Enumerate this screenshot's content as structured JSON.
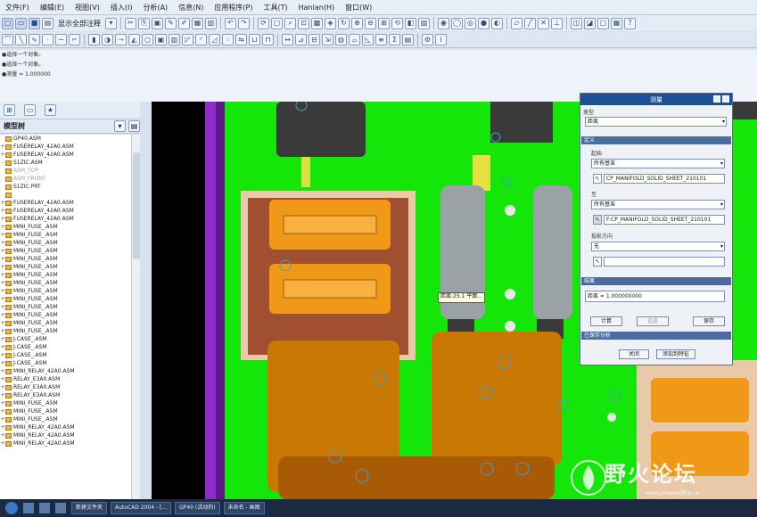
{
  "menu": [
    "文件(F)",
    "编辑(E)",
    "视图(V)",
    "插入(I)",
    "分析(A)",
    "信息(N)",
    "应用程序(P)",
    "工具(T)",
    "Hanlan(H)",
    "窗口(W)"
  ],
  "toolbar": {
    "display_label": "显示全部注释"
  },
  "messages": [
    "●选择一个对象。",
    "●选择一个对象。",
    "●测量 = 1.000000"
  ],
  "model_tree": {
    "title": "模型树",
    "items": [
      {
        "label": "GP40.ASM",
        "exp": "",
        "dim": false
      },
      {
        "label": "FUSERELAY_42A0.ASM",
        "exp": "+",
        "dim": false
      },
      {
        "label": "FUSERELAY_42A0.ASM",
        "exp": "+",
        "dim": false
      },
      {
        "label": "S1ZIC.ASM",
        "exp": "-",
        "dim": false
      },
      {
        "label": "ASM_TOP",
        "exp": "",
        "dim": true
      },
      {
        "label": "ASM_FRONT",
        "exp": "",
        "dim": true
      },
      {
        "label": "S1ZIC.PRT",
        "exp": "",
        "dim": false
      },
      {
        "label": "",
        "exp": "",
        "dim": true
      },
      {
        "label": "FUSERELAY_42A0.ASM",
        "exp": "+",
        "dim": false
      },
      {
        "label": "FUSERELAY_42A0.ASM",
        "exp": "+",
        "dim": false
      },
      {
        "label": "FUSERELAY_42A0.ASM",
        "exp": "+",
        "dim": false
      },
      {
        "label": "MINI_FUSE_.ASM",
        "exp": "+",
        "dim": false
      },
      {
        "label": "MINI_FUSE_.ASM",
        "exp": "+",
        "dim": false
      },
      {
        "label": "MINI_FUSE_.ASM",
        "exp": "+",
        "dim": false
      },
      {
        "label": "MINI_FUSE_.ASM",
        "exp": "+",
        "dim": false
      },
      {
        "label": "MINI_FUSE_.ASM",
        "exp": "+",
        "dim": false
      },
      {
        "label": "MINI_FUSE_.ASM",
        "exp": "+",
        "dim": false
      },
      {
        "label": "MINI_FUSE_.ASM",
        "exp": "+",
        "dim": false
      },
      {
        "label": "MINI_FUSE_.ASM",
        "exp": "+",
        "dim": false
      },
      {
        "label": "MINI_FUSE_.ASM",
        "exp": "+",
        "dim": false
      },
      {
        "label": "MINI_FUSE_.ASM",
        "exp": "+",
        "dim": false
      },
      {
        "label": "MINI_FUSE_.ASM",
        "exp": "+",
        "dim": false
      },
      {
        "label": "MINI_FUSE_.ASM",
        "exp": "+",
        "dim": false
      },
      {
        "label": "MINI_FUSE_.ASM",
        "exp": "+",
        "dim": false
      },
      {
        "label": "MINI_FUSE_.ASM",
        "exp": "+",
        "dim": false
      },
      {
        "label": "J-CASE_.ASM",
        "exp": "+",
        "dim": false
      },
      {
        "label": "J-CASE_.ASM",
        "exp": "+",
        "dim": false
      },
      {
        "label": "J-CASE_.ASM",
        "exp": "+",
        "dim": false
      },
      {
        "label": "J-CASE_.ASM",
        "exp": "+",
        "dim": false
      },
      {
        "label": "MINI_RELAY_42A0.ASM",
        "exp": "+",
        "dim": false
      },
      {
        "label": "RELAY_E3A0.ASM",
        "exp": "+",
        "dim": false
      },
      {
        "label": "RELAY_E3A0.ASM",
        "exp": "+",
        "dim": false
      },
      {
        "label": "RELAY_E3A0.ASM",
        "exp": "+",
        "dim": false
      },
      {
        "label": "MINI_FUSE_.ASM",
        "exp": "+",
        "dim": false
      },
      {
        "label": "MINI_FUSE_.ASM",
        "exp": "+",
        "dim": false
      },
      {
        "label": "MINI_FUSE_.ASM",
        "exp": "+",
        "dim": false
      },
      {
        "label": "MINI_RELAY_42A0.ASM",
        "exp": "+",
        "dim": false
      },
      {
        "label": "MINI_RELAY_42A0.ASM",
        "exp": "+",
        "dim": false
      },
      {
        "label": "MINI_RELAY_42A0.ASM",
        "exp": "+",
        "dim": false
      }
    ]
  },
  "viewport": {
    "tooltip": "距离:25.1 平面..."
  },
  "dialog": {
    "title": "测量",
    "type_label": "类型",
    "type_value": "距离",
    "define_label": "定义",
    "from_label": "起始",
    "from_value": "所有基准",
    "from_ref": "CP_MANIFOLD_SOLID_SHEET_210101",
    "to_label": "至",
    "to_value": "所有基准",
    "to_ref": "F:CP_MANIFOLD_SOLID_SHEET_210101",
    "projection_label": "投影方向",
    "projection_value": "无",
    "result_label": "结果",
    "result_value": "距离 = 1.000000000",
    "calc_button": "计算",
    "info_button": "信息",
    "save_button": "保存",
    "analysis_section": "已保存分析",
    "close_button": "关闭",
    "add_button": "添加到特征"
  },
  "taskbar": {
    "tasks": [
      "新建文件夹",
      "AutoCAD 2004 - [...",
      "GP40 (活动的)",
      "未命名 - 画图"
    ]
  },
  "watermark": {
    "text": "野火论坛",
    "url": "www.proewildfire.cn"
  }
}
